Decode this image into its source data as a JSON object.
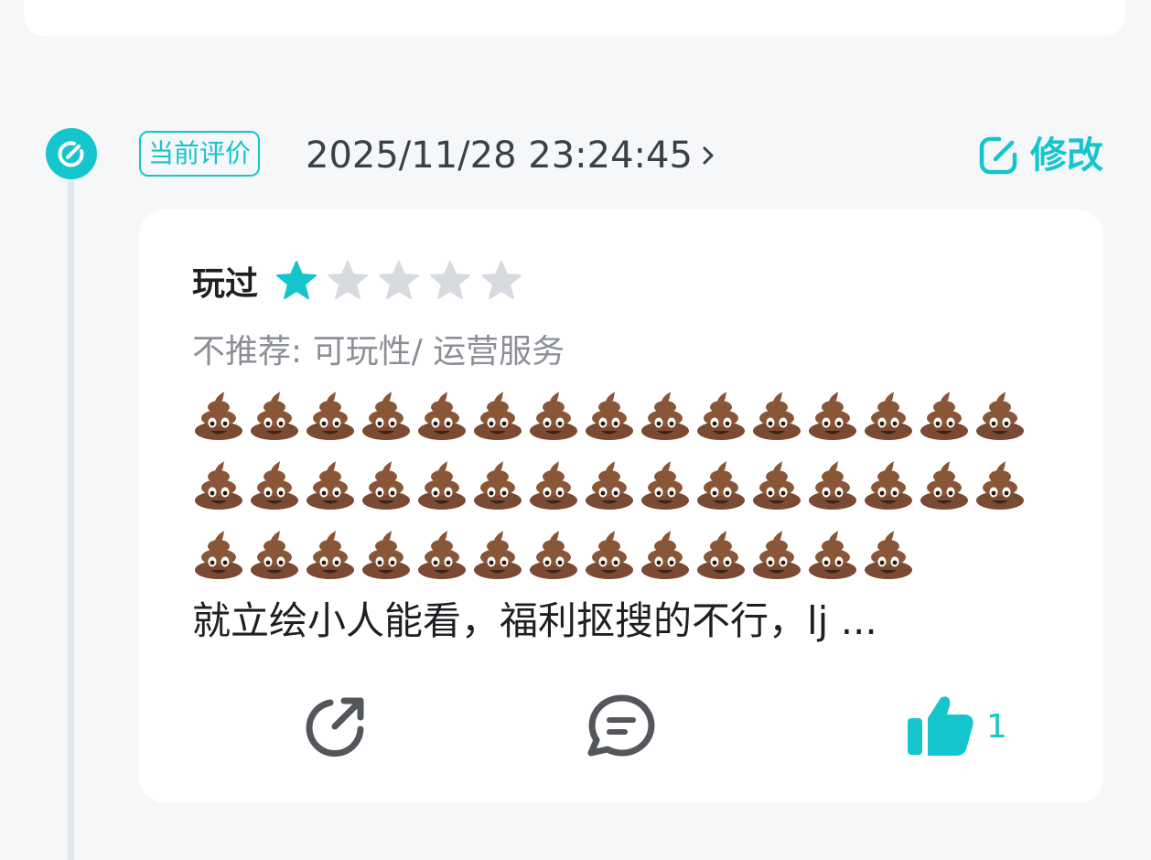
{
  "review": {
    "badge": "当前评价",
    "timestamp": "2025/11/28 23:24:45",
    "edit_label": "修改",
    "status": "玩过",
    "rating": 1,
    "max_rating": 5,
    "tags": "不推荐: 可玩性/ 运营服务",
    "emoji_rows": [
      15,
      15,
      13
    ],
    "text": "就立绘小人能看，福利抠搜的不行，lj ...",
    "like_count": "1"
  },
  "icons": {
    "timeline": "edit-circle-icon",
    "chevron": "chevron-right-icon",
    "edit": "edit-icon",
    "star": "star-icon",
    "emoji": "pile-of-poo-emoji",
    "share": "share-icon",
    "comment": "comment-icon",
    "like": "thumbs-up-icon"
  },
  "colors": {
    "accent": "#15c5ce",
    "star_empty": "#d7dade",
    "background": "#f5f7f9",
    "text_primary": "#1e1f22",
    "text_secondary": "#8c9096",
    "icon_gray": "#53565b"
  }
}
